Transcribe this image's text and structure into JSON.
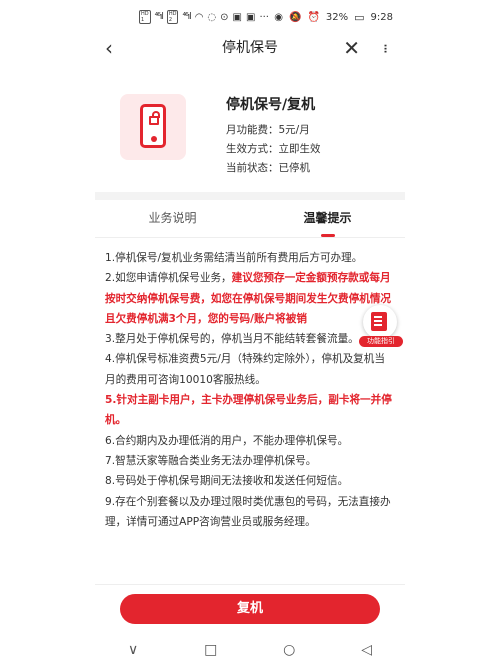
{
  "status_bar": {
    "sim1": "HD",
    "sim2": "HD",
    "signal1": "⁴⁶ıl",
    "signal2": "⁴⁶ıl",
    "battery": "32%",
    "time": "9:28"
  },
  "nav": {
    "title": "停机保号"
  },
  "product": {
    "name": "停机保号/复机",
    "fee": "月功能费：5元/月",
    "effect": "生效方式：立即生效",
    "state": "当前状态：已停机",
    "icon": "phone-lock-icon"
  },
  "tabs": [
    {
      "label": "业务说明"
    },
    {
      "label": "温馨提示"
    }
  ],
  "tips": {
    "t1": "1.停机保号/复机业务需结清当前所有费用后方可办理。",
    "t2a": "2.如您申请停机保号业务，",
    "t2b": "建议您预存一定金额预存款或每月按时交纳停机保号费，如您在停机保号期间发生欠费停机情况且欠费停机满3个月，您的号码/账户将被销",
    "t3": "3.整月处于停机保号的，停机当月不能结转套餐流量。",
    "t4": "4.停机保号标准资费5元/月（特殊约定除外），停机及复机当月的费用可咨询10010客服热线。",
    "t5": "5.针对主副卡用户，主卡办理停机保号业务后，副卡将一并停机。",
    "t6": "6.合约期内及办理低消的用户，不能办理停机保号。",
    "t7": "7.智慧沃家等融合类业务无法办理停机保号。",
    "t8": "8.号码处于停机保号期间无法接收和发送任何短信。",
    "t9": "9.存在个别套餐以及办理过限时类优惠包的号码，无法直接办理，详情可通过APP咨询营业员或服务经理。"
  },
  "float_guide": {
    "label": "功能指引",
    "icon": "guide-doc-icon"
  },
  "cta": {
    "label": "复机"
  },
  "system_nav": {
    "back": "◁",
    "home": "○",
    "recent": "□",
    "down": "∨"
  },
  "colors": {
    "accent": "#e3252e",
    "tint": "#fde9ea"
  }
}
